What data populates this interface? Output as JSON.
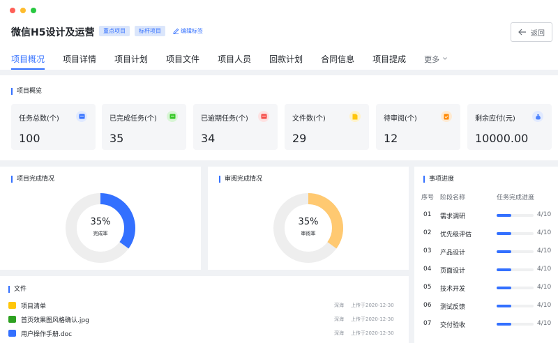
{
  "window": {
    "dots": [
      "#ff5f57",
      "#febc2e",
      "#28c840"
    ]
  },
  "header": {
    "title": "微信H5设计及运营",
    "tags": [
      "重点项目",
      "标杆项目"
    ],
    "edit_label": "编辑标签",
    "back_label": "返回"
  },
  "tabs": [
    {
      "label": "项目概况",
      "active": true
    },
    {
      "label": "项目详情"
    },
    {
      "label": "项目计划"
    },
    {
      "label": "项目文件"
    },
    {
      "label": "项目人员"
    },
    {
      "label": "回款计划"
    },
    {
      "label": "合同信息"
    },
    {
      "label": "项目提成"
    }
  ],
  "more_label": "更多",
  "overview": {
    "title": "项目概览",
    "stats": [
      {
        "label": "任务总数(个)",
        "value": "100",
        "icon": "inbox-icon",
        "color": "#3370ff",
        "bg": "#e1eaff"
      },
      {
        "label": "已完成任务(个)",
        "value": "35",
        "icon": "inbox-check-icon",
        "color": "#34c724",
        "bg": "#d9f5d6"
      },
      {
        "label": "已逾期任务(个)",
        "value": "34",
        "icon": "inbox-alert-icon",
        "color": "#f54a45",
        "bg": "#fde2e2"
      },
      {
        "label": "文件数(个)",
        "value": "29",
        "icon": "file-icon",
        "color": "#ffc60a",
        "bg": "#fff3c9"
      },
      {
        "label": "待审阅(个)",
        "value": "12",
        "icon": "review-icon",
        "color": "#ff8800",
        "bg": "#feead2"
      },
      {
        "label": "剩余应付(元)",
        "value": "10000.00",
        "icon": "money-bag-icon",
        "color": "#4e83fd",
        "bg": "#e1eaff"
      }
    ]
  },
  "project_completion": {
    "title": "项目完成情况",
    "percent_label": "35%",
    "percent": 35,
    "sub": "完成率",
    "color": "#3370ff"
  },
  "review_completion": {
    "title": "审阅完成情况",
    "percent_label": "35%",
    "percent": 35,
    "sub": "审阅率",
    "color": "#ffc971"
  },
  "progress": {
    "title": "事项进度",
    "headers": {
      "no": "序号",
      "name": "阶段名称",
      "progress": "任务完成进度"
    },
    "rows": [
      {
        "no": "01",
        "name": "需求调研",
        "count": "4/10",
        "value": 0.4
      },
      {
        "no": "02",
        "name": "优先级评估",
        "count": "4/10",
        "value": 0.4
      },
      {
        "no": "03",
        "name": "产品设计",
        "count": "4/10",
        "value": 0.4
      },
      {
        "no": "04",
        "name": "页面设计",
        "count": "4/10",
        "value": 0.4
      },
      {
        "no": "05",
        "name": "技术开发",
        "count": "4/10",
        "value": 0.4
      },
      {
        "no": "06",
        "name": "测试反馈",
        "count": "4/10",
        "value": 0.4
      },
      {
        "no": "07",
        "name": "交付验收",
        "count": "4/10",
        "value": 0.4
      }
    ]
  },
  "files": {
    "title": "文件",
    "rows": [
      {
        "name": "项目清单",
        "icon": "folder-icon",
        "color": "#ffc60a",
        "owner": "深海",
        "time": "上传于2020-12-30"
      },
      {
        "name": "首页效果图风格确认.jpg",
        "icon": "image-file-icon",
        "color": "#2ea121",
        "owner": "深海",
        "time": "上传于2020-12-30"
      },
      {
        "name": "用户操作手册.doc",
        "icon": "doc-file-icon",
        "color": "#3370ff",
        "owner": "深海",
        "time": "上传于2020-12-30"
      }
    ]
  }
}
